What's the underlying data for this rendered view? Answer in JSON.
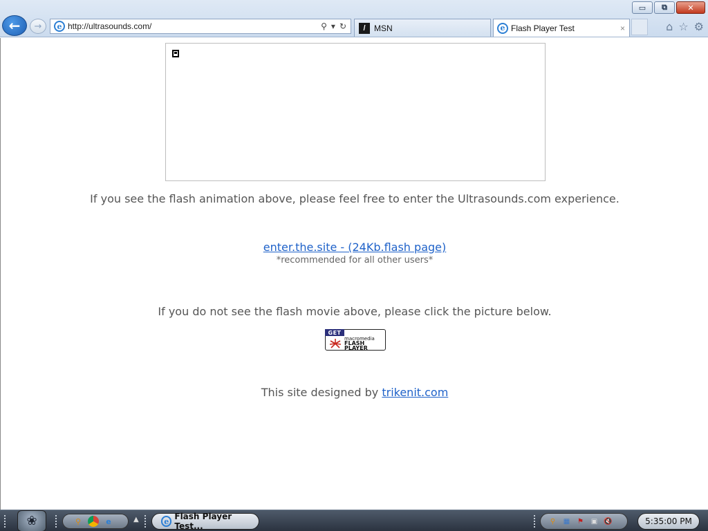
{
  "browser": {
    "url": "http://ultrasounds.com/",
    "tabs": [
      {
        "label": "MSN"
      },
      {
        "label": "Flash Player Test"
      }
    ],
    "tab_close": "×",
    "window_buttons": {
      "minimize": "▭",
      "restore": "⧉",
      "close": "✕"
    }
  },
  "page": {
    "line1": "If you see the flash animation above, please feel free to enter the Ultrasounds.com experience.",
    "enter_link": "enter.the.site - (24Kb.flash page)",
    "recommended": "*recommended for all other users*",
    "line2": "If you do not see the flash movie above, please click the picture below.",
    "flash_badge": {
      "get": "GET",
      "brand": "macromedia",
      "product_line1": "FLASH",
      "product_line2": "PLAYER"
    },
    "designed_by_prefix": "This site designed by ",
    "designed_by_link": "trikenit.com"
  },
  "taskbar": {
    "task_button": "Flash Player Test...",
    "clock": "5:35:00 PM"
  },
  "colors": {
    "link": "#1f62c9",
    "body_text": "#555555"
  }
}
